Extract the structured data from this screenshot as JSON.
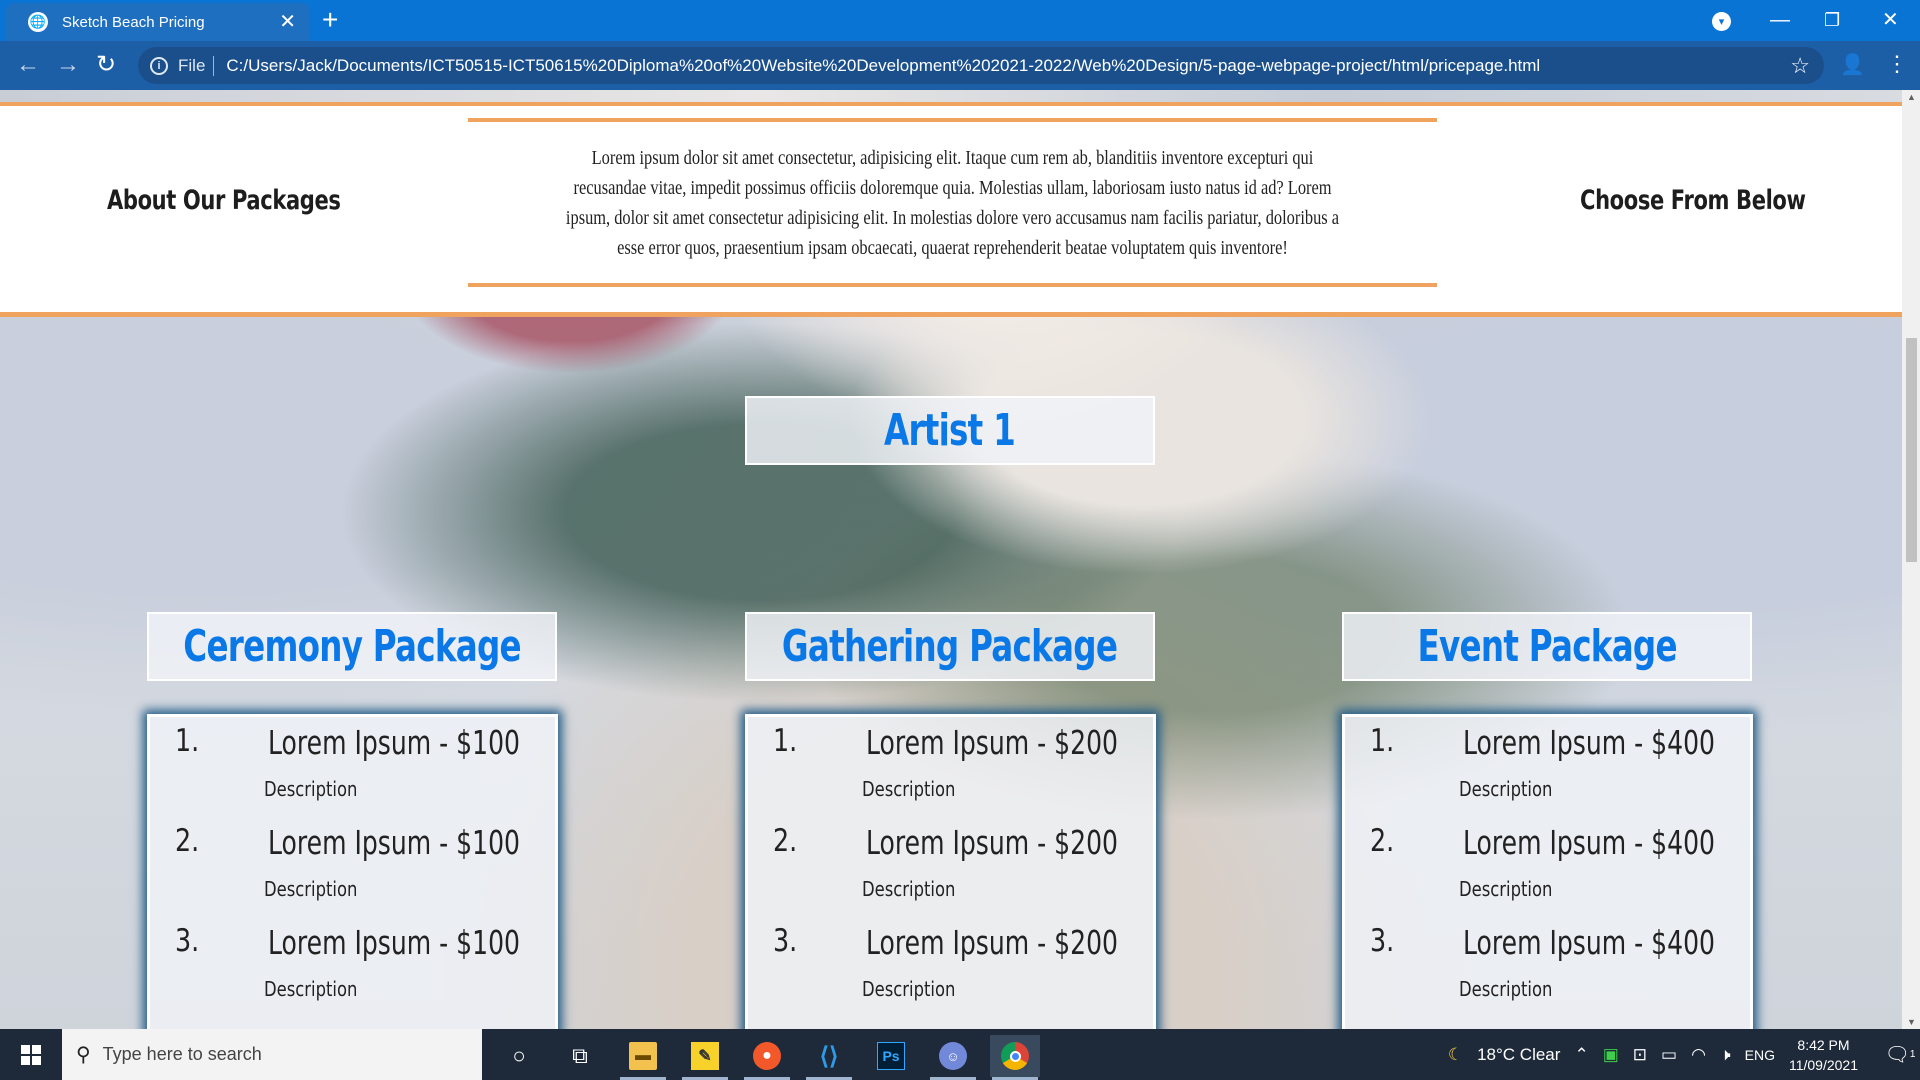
{
  "browser": {
    "tab_title": "Sketch Beach Pricing",
    "tab_close": "✕",
    "new_tab": "+",
    "omnibox": {
      "scheme_label": "File",
      "url": "C:/Users/Jack/Documents/ICT50515-ICT50615%20Diploma%20of%20Website%20Development%202021-2022/Web%20Design/5-page-webpage-project/html/pricepage.html"
    }
  },
  "page": {
    "about": {
      "left_heading": "About Our Packages",
      "right_heading": "Choose From Below",
      "body": "Lorem ipsum dolor sit amet consectetur, adipisicing elit. Itaque cum rem ab, blanditiis inventore excepturi qui recusandae vitae, impedit possimus officiis doloremque quia. Molestias ullam, laboriosam iusto natus id ad? Lorem ipsum, dolor sit amet consectetur adipisicing elit. In molestias dolore vero accusamus nam facilis pariatur, doloribus a esse error quos, praesentium ipsam obcaecati, quaerat reprehenderit beatae voluptatem quis inventore!"
    },
    "artist_title": "Artist 1",
    "packages": [
      {
        "title": "Ceremony Package",
        "items": [
          {
            "num": "1.",
            "name": "Lorem Ipsum - $100",
            "desc": "Description"
          },
          {
            "num": "2.",
            "name": "Lorem Ipsum - $100",
            "desc": "Description"
          },
          {
            "num": "3.",
            "name": "Lorem Ipsum - $100",
            "desc": "Description"
          }
        ]
      },
      {
        "title": "Gathering Package",
        "items": [
          {
            "num": "1.",
            "name": "Lorem Ipsum - $200",
            "desc": "Description"
          },
          {
            "num": "2.",
            "name": "Lorem Ipsum - $200",
            "desc": "Description"
          },
          {
            "num": "3.",
            "name": "Lorem Ipsum - $200",
            "desc": "Description"
          }
        ]
      },
      {
        "title": "Event Package",
        "items": [
          {
            "num": "1.",
            "name": "Lorem Ipsum - $400",
            "desc": "Description"
          },
          {
            "num": "2.",
            "name": "Lorem Ipsum - $400",
            "desc": "Description"
          },
          {
            "num": "3.",
            "name": "Lorem Ipsum - $400",
            "desc": "Description"
          }
        ]
      }
    ]
  },
  "taskbar": {
    "search_placeholder": "Type here to search",
    "weather": "18°C  Clear",
    "language": "ENG",
    "time": "8:42 PM",
    "date": "11/09/2021",
    "notification_count": "1",
    "apps": [
      "task-view",
      "file-explorer",
      "sticky-notes",
      "firefox",
      "vscode",
      "photoshop",
      "discord",
      "chrome"
    ]
  },
  "colors": {
    "accent_orange": "#f0a35e",
    "title_blue": "#0a78e6",
    "chrome_blue": "#0a74d4",
    "box_glow": "#1f5a86"
  }
}
